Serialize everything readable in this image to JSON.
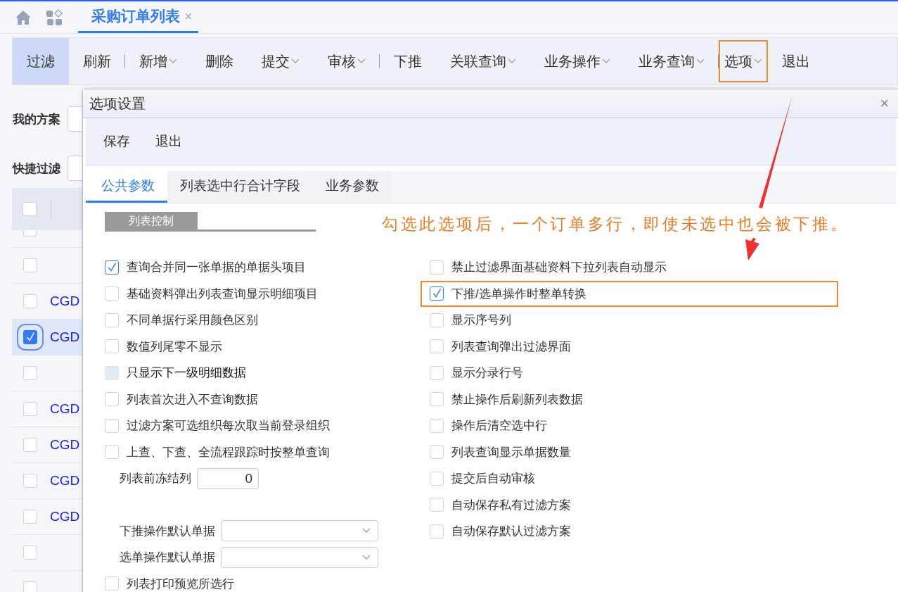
{
  "page_tabs": [
    {
      "label": "采购订单列表",
      "selected": true,
      "close": "×"
    }
  ],
  "toolbar": [
    {
      "label": "过滤",
      "dropdown": false,
      "selected": true,
      "highlighted": false,
      "divider_after": false
    },
    {
      "label": "刷新",
      "dropdown": false,
      "selected": false,
      "highlighted": false,
      "divider_after": true
    },
    {
      "label": "新增",
      "dropdown": true,
      "selected": false,
      "highlighted": false,
      "divider_after": false
    },
    {
      "label": "删除",
      "dropdown": false,
      "selected": false,
      "highlighted": false,
      "divider_after": false
    },
    {
      "label": "提交",
      "dropdown": true,
      "selected": false,
      "highlighted": false,
      "divider_after": false
    },
    {
      "label": "审核",
      "dropdown": true,
      "selected": false,
      "highlighted": false,
      "divider_after": true
    },
    {
      "label": "下推",
      "dropdown": false,
      "selected": false,
      "highlighted": false,
      "divider_after": false
    },
    {
      "label": "关联查询",
      "dropdown": true,
      "selected": false,
      "highlighted": false,
      "divider_after": false
    },
    {
      "label": "业务操作",
      "dropdown": true,
      "selected": false,
      "highlighted": false,
      "divider_after": false
    },
    {
      "label": "业务查询",
      "dropdown": true,
      "selected": false,
      "highlighted": false,
      "divider_after": true
    },
    {
      "label": "选项",
      "dropdown": true,
      "selected": false,
      "highlighted": true,
      "divider_after": false
    },
    {
      "label": "退出",
      "dropdown": false,
      "selected": false,
      "highlighted": false,
      "divider_after": false
    }
  ],
  "filters": [
    {
      "label": "我的方案"
    },
    {
      "label": "快捷过滤"
    }
  ],
  "table": {
    "header_checked": false,
    "rows": [
      {
        "checked": false,
        "selected": false
      },
      {
        "checked": false,
        "selected": false
      },
      {
        "checked": false,
        "selected": false,
        "code": "CGD"
      },
      {
        "checked": true,
        "selected": true,
        "code": "CGD"
      },
      {
        "checked": false,
        "selected": false
      },
      {
        "checked": false,
        "selected": false,
        "code": "CGD"
      },
      {
        "checked": false,
        "selected": false,
        "code": "CGD"
      },
      {
        "checked": false,
        "selected": false,
        "code": "CGD"
      },
      {
        "checked": false,
        "selected": false,
        "code": "CGD"
      },
      {
        "checked": false,
        "selected": false
      },
      {
        "checked": false,
        "selected": false
      }
    ]
  },
  "dialog": {
    "title": "选项设置",
    "close": "×",
    "buttons": [
      "保存",
      "退出"
    ],
    "tabs": [
      {
        "label": "公共参数",
        "selected": true
      },
      {
        "label": "列表选中行合计字段",
        "selected": false
      },
      {
        "label": "业务参数",
        "selected": false
      }
    ],
    "section": "列表控制",
    "annotation": "勾选此选项后，一个订单多行，即使未选中也会被下推。",
    "left_options": [
      {
        "kind": "checkbox",
        "label": "查询合并同一张单据的单据头项目",
        "checked": true,
        "disabled": false
      },
      {
        "kind": "checkbox",
        "label": "基础资料弹出列表查询显示明细项目",
        "checked": false,
        "disabled": false
      },
      {
        "kind": "checkbox",
        "label": "不同单据行采用颜色区别",
        "checked": false,
        "disabled": false
      },
      {
        "kind": "checkbox",
        "label": "数值列尾零不显示",
        "checked": false,
        "disabled": false
      },
      {
        "kind": "checkbox",
        "label": "只显示下一级明细数据",
        "checked": false,
        "disabled": true
      },
      {
        "kind": "checkbox",
        "label": "列表首次进入不查询数据",
        "checked": false,
        "disabled": false
      },
      {
        "kind": "checkbox",
        "label": "过滤方案可选组织每次取当前登录组织",
        "checked": false,
        "disabled": false
      },
      {
        "kind": "checkbox",
        "label": "上查、下查、全流程跟踪时按整单查询",
        "checked": false,
        "disabled": false
      },
      {
        "kind": "number",
        "label": "列表前冻结列",
        "value": "0"
      },
      {
        "kind": "select",
        "label": "下推操作默认单据"
      },
      {
        "kind": "select",
        "label": "选单操作默认单据"
      },
      {
        "kind": "checkbox",
        "label": "列表打印预览所选行",
        "checked": false,
        "disabled": false
      }
    ],
    "right_options": [
      {
        "label": "禁止过滤界面基础资料下拉列表自动显示",
        "checked": false,
        "highlighted": false
      },
      {
        "label": "下推/选单操作时整单转换",
        "checked": true,
        "highlighted": true
      },
      {
        "label": "显示序号列",
        "checked": false,
        "highlighted": false
      },
      {
        "label": "列表查询弹出过滤界面",
        "checked": false,
        "highlighted": false
      },
      {
        "label": "显示分录行号",
        "checked": false,
        "highlighted": false
      },
      {
        "label": "禁止操作后刷新列表数据",
        "checked": false,
        "highlighted": false
      },
      {
        "label": "操作后清空选中行",
        "checked": false,
        "highlighted": false
      },
      {
        "label": "列表查询显示单据数量",
        "checked": false,
        "highlighted": false
      },
      {
        "label": "提交后自动审核",
        "checked": false,
        "highlighted": false
      },
      {
        "label": "自动保存私有过滤方案",
        "checked": false,
        "highlighted": false
      },
      {
        "label": "自动保存默认过滤方案",
        "checked": false,
        "highlighted": false
      }
    ]
  }
}
